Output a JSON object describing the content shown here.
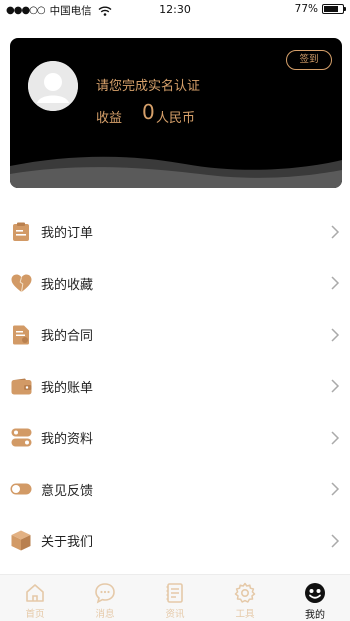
{
  "status_bar": {
    "signal": "●●●○○",
    "carrier": "中国电信",
    "time": "12:30",
    "battery": "77%",
    "battery_level": 0.77
  },
  "profile": {
    "verify_prompt": "请您完成实名认证",
    "income_label": "收益",
    "income_value": "0",
    "income_unit": "人民币",
    "signin_label": "签到"
  },
  "menu": {
    "items": [
      {
        "label": "我的订单",
        "icon": "clipboard-icon"
      },
      {
        "label": "我的收藏",
        "icon": "heart-icon"
      },
      {
        "label": "我的合同",
        "icon": "contract-icon"
      },
      {
        "label": "我的账单",
        "icon": "wallet-icon"
      },
      {
        "label": "我的资料",
        "icon": "profile-data-icon"
      },
      {
        "label": "意见反馈",
        "icon": "toggle-icon"
      },
      {
        "label": "关于我们",
        "icon": "box-icon"
      }
    ]
  },
  "tab_bar": {
    "tabs": [
      {
        "label": "首页",
        "icon": "home-icon",
        "active": false
      },
      {
        "label": "消息",
        "icon": "message-icon",
        "active": false
      },
      {
        "label": "资讯",
        "icon": "news-icon",
        "active": false
      },
      {
        "label": "工具",
        "icon": "gear-icon",
        "active": false
      },
      {
        "label": "我的",
        "icon": "smiley-icon",
        "active": true
      }
    ]
  },
  "colors": {
    "accent": "#d6a06a",
    "icon_brown": "#d29a66",
    "card_bg": "#000000",
    "tab_inactive": "#e5c9a8"
  }
}
